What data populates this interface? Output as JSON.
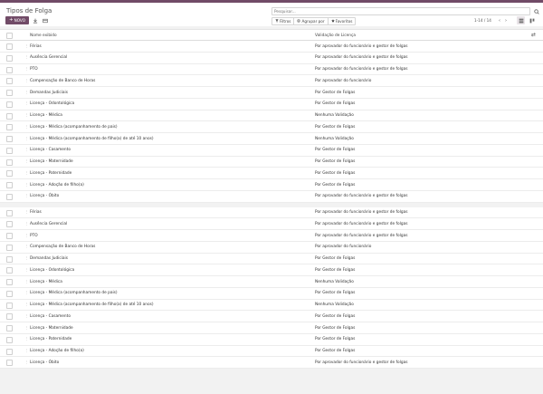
{
  "page": {
    "title": "Tipos de Folga"
  },
  "toolbar": {
    "new_label": "NOVO",
    "search_placeholder": "Pesquisar...",
    "filters_label": "Filtros",
    "group_label": "Agrupar por",
    "favorites_label": "Favoritos",
    "pager_text": "1-14 / 14"
  },
  "table": {
    "headers": {
      "name": "Nome exibido",
      "validation": "Validação de Licença"
    },
    "groups": [
      [
        {
          "name": "Férias",
          "validation": "Por aprovador do funcionário e gestor de folgas"
        },
        {
          "name": "Ausência Gerencial",
          "validation": "Por aprovador do funcionário e gestor de folgas"
        },
        {
          "name": "PTO",
          "validation": "Por aprovador do funcionário e gestor de folgas"
        },
        {
          "name": "Compensação de Banco de Horas",
          "validation": "Por aprovador do funcionário"
        },
        {
          "name": "Demandas Judiciais",
          "validation": "Por Gestor de Folgas"
        },
        {
          "name": "Licença - Odontológica",
          "validation": "Por Gestor de Folgas"
        },
        {
          "name": "Licença - Médica",
          "validation": "Nenhuma Validação"
        },
        {
          "name": "Licença - Médica (acompanhamento de pais)",
          "validation": "Por Gestor de Folgas"
        },
        {
          "name": "Licença - Médica (acompanhamento de filho(a) de até 10 anos)",
          "validation": "Nenhuma Validação"
        },
        {
          "name": "Licença - Casamento",
          "validation": "Por Gestor de Folgas"
        },
        {
          "name": "Licença - Maternidade",
          "validation": "Por Gestor de Folgas"
        },
        {
          "name": "Licença - Paternidade",
          "validation": "Por Gestor de Folgas"
        },
        {
          "name": "Licença - Adoção de filho(a)",
          "validation": "Por Gestor de Folgas"
        },
        {
          "name": "Licença - Óbito",
          "validation": "Por aprovador do funcionário e gestor de folgas"
        }
      ],
      [
        {
          "name": "Férias",
          "validation": "Por aprovador do funcionário e gestor de folgas"
        },
        {
          "name": "Ausência Gerencial",
          "validation": "Por aprovador do funcionário e gestor de folgas"
        },
        {
          "name": "PTO",
          "validation": "Por aprovador do funcionário e gestor de folgas"
        },
        {
          "name": "Compensação de Banco de Horas",
          "validation": "Por aprovador do funcionário"
        },
        {
          "name": "Demandas Judiciais",
          "validation": "Por Gestor de Folgas"
        },
        {
          "name": "Licença - Odontológica",
          "validation": "Por Gestor de Folgas"
        },
        {
          "name": "Licença - Médica",
          "validation": "Nenhuma Validação"
        },
        {
          "name": "Licença - Médica (acompanhamento de pais)",
          "validation": "Por Gestor de Folgas"
        },
        {
          "name": "Licença - Médica (acompanhamento de filho(a) de até 10 anos)",
          "validation": "Nenhuma Validação"
        },
        {
          "name": "Licença - Casamento",
          "validation": "Por Gestor de Folgas"
        },
        {
          "name": "Licença - Maternidade",
          "validation": "Por Gestor de Folgas"
        },
        {
          "name": "Licença - Paternidade",
          "validation": "Por Gestor de Folgas"
        },
        {
          "name": "Licença - Adoção de filho(a)",
          "validation": "Por Gestor de Folgas"
        },
        {
          "name": "Licença - Óbito",
          "validation": "Por aprovador do funcionário e gestor de folgas"
        }
      ]
    ]
  },
  "icons": {
    "download": "download-icon",
    "settings": "settings-icon",
    "search": "search-icon",
    "list_view": "list-view-icon",
    "kanban_view": "kanban-view-icon",
    "column_adjust": "column-adjust-icon",
    "drag_handle": "drag-handle-icon"
  },
  "colors": {
    "brand": "#714b67",
    "background": "#f2f2f2"
  }
}
